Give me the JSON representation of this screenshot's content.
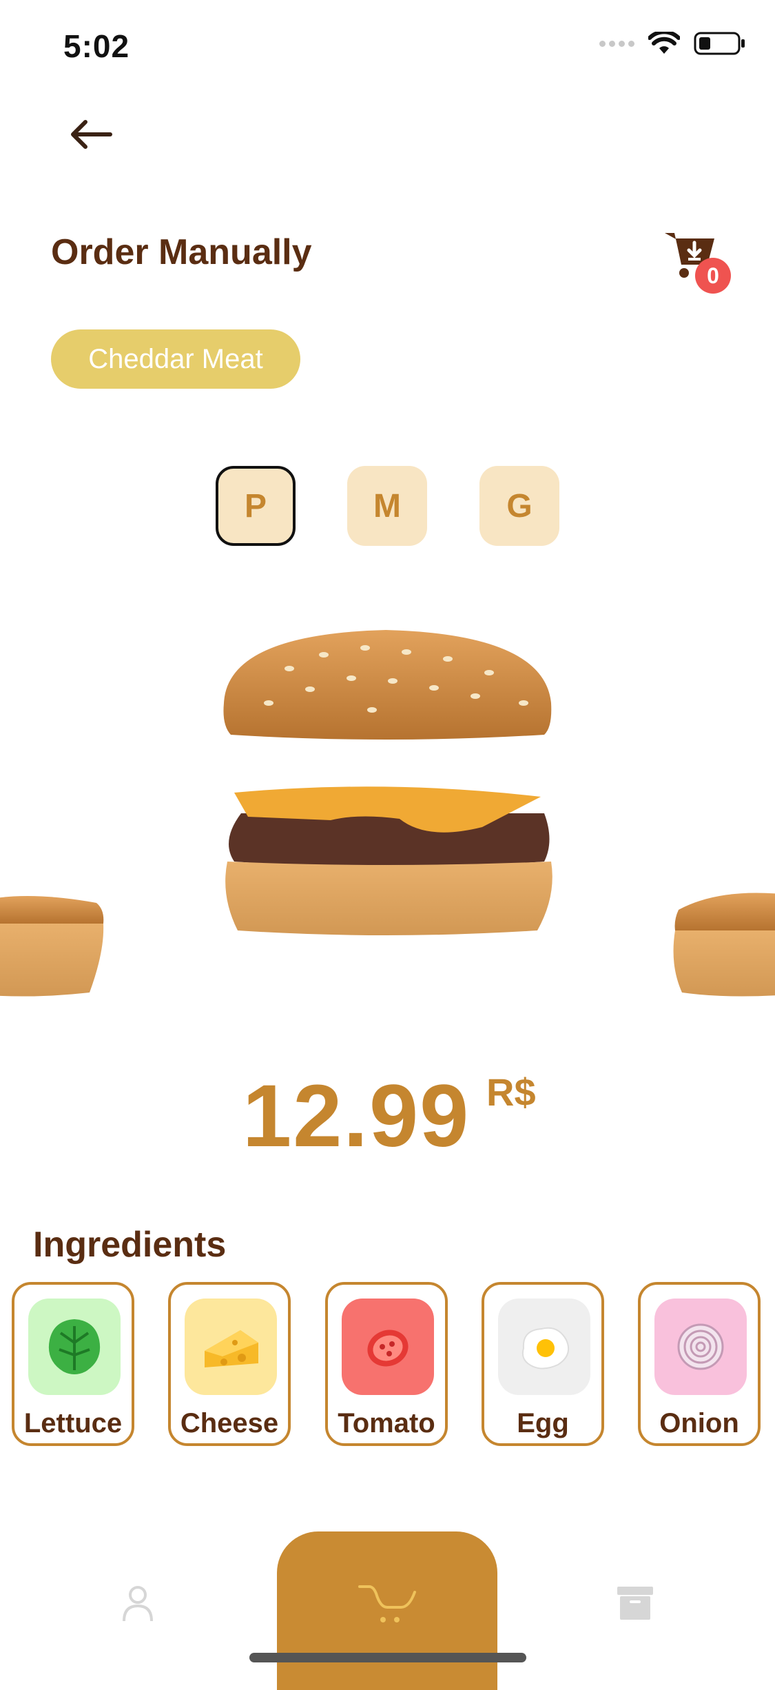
{
  "status_bar": {
    "time": "5:02"
  },
  "header": {
    "title": "Order Manually",
    "cart_count": "0"
  },
  "product": {
    "name": "Cheddar Meat"
  },
  "sizes": [
    {
      "label": "P",
      "selected": true
    },
    {
      "label": "M",
      "selected": false
    },
    {
      "label": "G",
      "selected": false
    }
  ],
  "price": {
    "value": "12.99",
    "currency": "R$"
  },
  "ingredients": {
    "title": "Ingredients",
    "items": [
      {
        "label": "Lettuce",
        "icon": "lettuce-icon",
        "bg": "#cdf7c3"
      },
      {
        "label": "Cheese",
        "icon": "cheese-icon",
        "bg": "#fde79c"
      },
      {
        "label": "Tomato",
        "icon": "tomato-icon",
        "bg": "#f7726e"
      },
      {
        "label": "Egg",
        "icon": "egg-icon",
        "bg": "#efefef"
      },
      {
        "label": "Onion",
        "icon": "onion-icon",
        "bg": "#f9c1dc"
      }
    ]
  },
  "nav": {
    "left": "profile-icon",
    "center": "cart-icon",
    "right": "archive-icon"
  },
  "colors": {
    "brand_brown": "#5a2d12",
    "accent_gold": "#c5862f",
    "nav_gold": "#c98b33",
    "chip_yellow": "#e6cd6b",
    "badge_red": "#ef5350"
  }
}
